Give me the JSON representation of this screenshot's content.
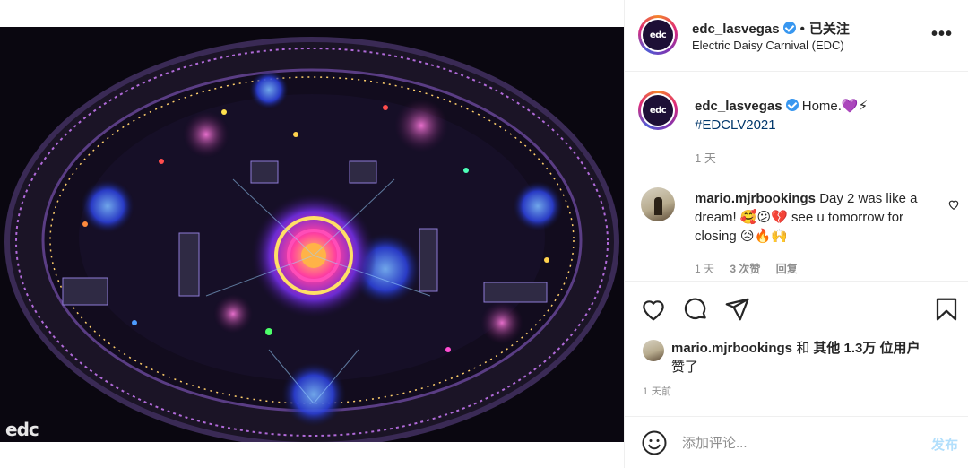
{
  "post": {
    "watermark": "edc"
  },
  "account": {
    "avatar_text": "edc",
    "username": "edc_lasvegas",
    "follow_status": "已关注",
    "subtitle": "Electric Daisy Carnival (EDC)",
    "more_icon": "more-horizontal-icon"
  },
  "caption": {
    "username": "edc_lasvegas",
    "text": "Home.💜⚡",
    "hashtag": "#EDCLV2021",
    "time": "1 天"
  },
  "comment": {
    "username": "mario.mjrbookings",
    "text": "Day 2 was like a dream! 🥰😕💔 see u tomorrow for closing 😥🔥🙌",
    "time": "1 天",
    "likes": "3 次赞",
    "reply": "回复"
  },
  "actions": {
    "icons": [
      "heart-icon",
      "comment-icon",
      "share-icon",
      "bookmark-icon"
    ]
  },
  "likes": {
    "username": "mario.mjrbookings",
    "connector": " 和 ",
    "others": "其他 1.3万 位用户",
    "suffix": "赞了"
  },
  "post_time": "1 天前",
  "comment_box": {
    "placeholder": "添加评论...",
    "post_label": "发布"
  },
  "colors": {
    "link": "#00376b",
    "verified": "#3897f0",
    "post_button_disabled": "#b2dffc",
    "secondary_text": "#8e8e8e"
  }
}
